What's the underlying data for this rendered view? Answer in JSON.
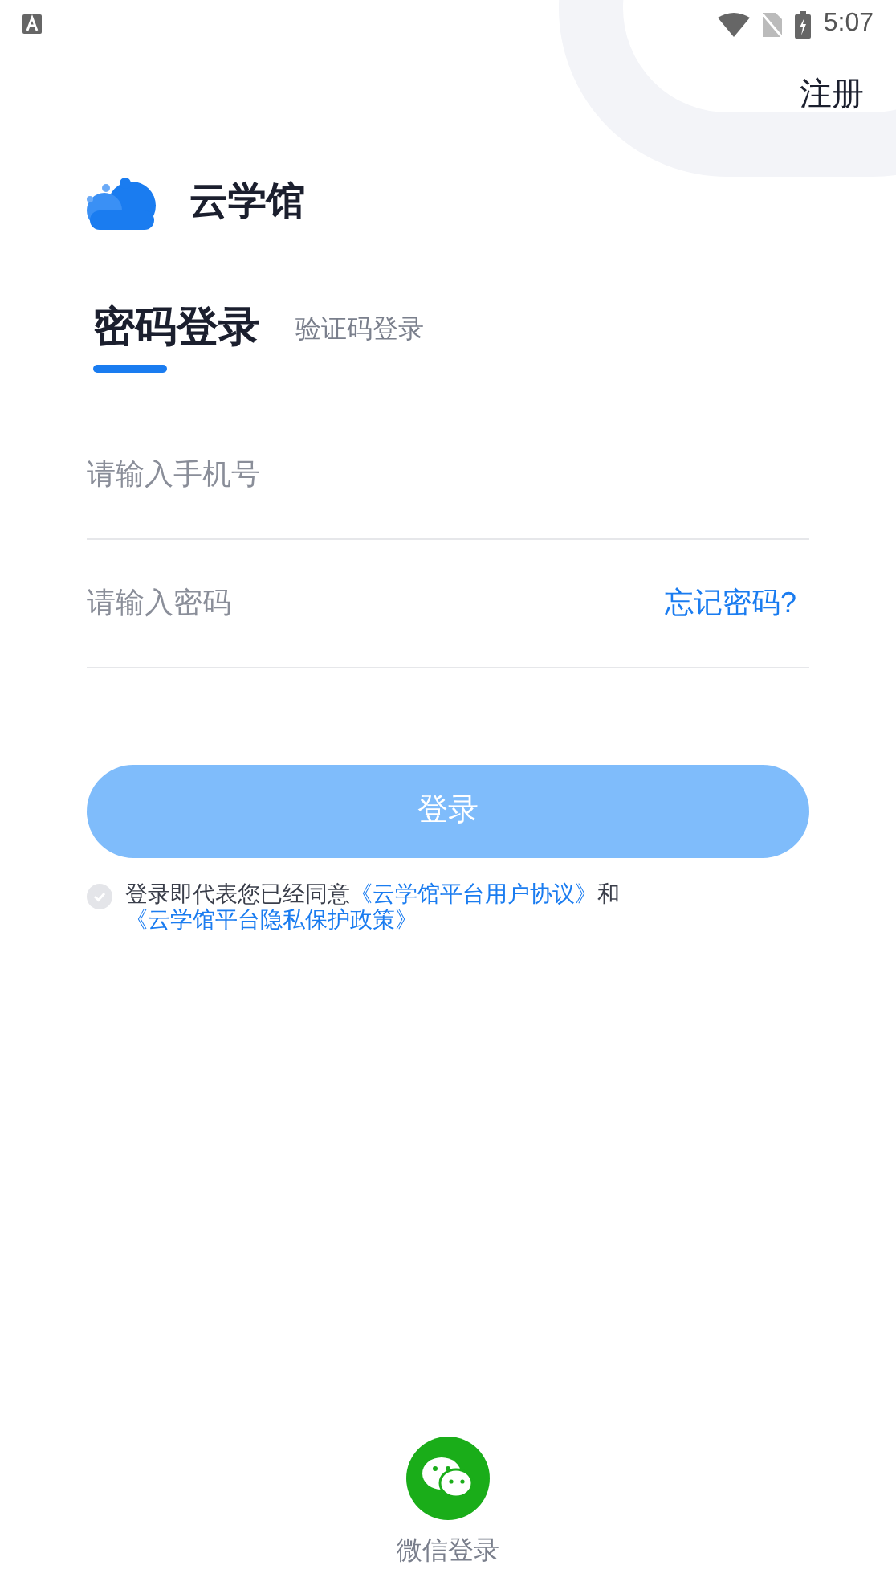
{
  "status_bar": {
    "time": "5:07"
  },
  "header": {
    "register": "注册"
  },
  "brand": {
    "name": "云学馆"
  },
  "tabs": [
    {
      "label": "密码登录",
      "selected": true
    },
    {
      "label": "验证码登录",
      "selected": false
    }
  ],
  "fields": [
    {
      "placeholder": "请输入手机号"
    },
    {
      "placeholder": "请输入密码",
      "link": "忘记密码?"
    }
  ],
  "login_button": {
    "label": "登录",
    "disabled": true
  },
  "agreement": {
    "checked": false,
    "text": "登录即代表您已经同意",
    "link1": "《云学馆平台用户协议》",
    "and": "和",
    "link2": "《云学馆平台隐私保护政策》"
  },
  "wechat": {
    "label": "微信登录"
  }
}
